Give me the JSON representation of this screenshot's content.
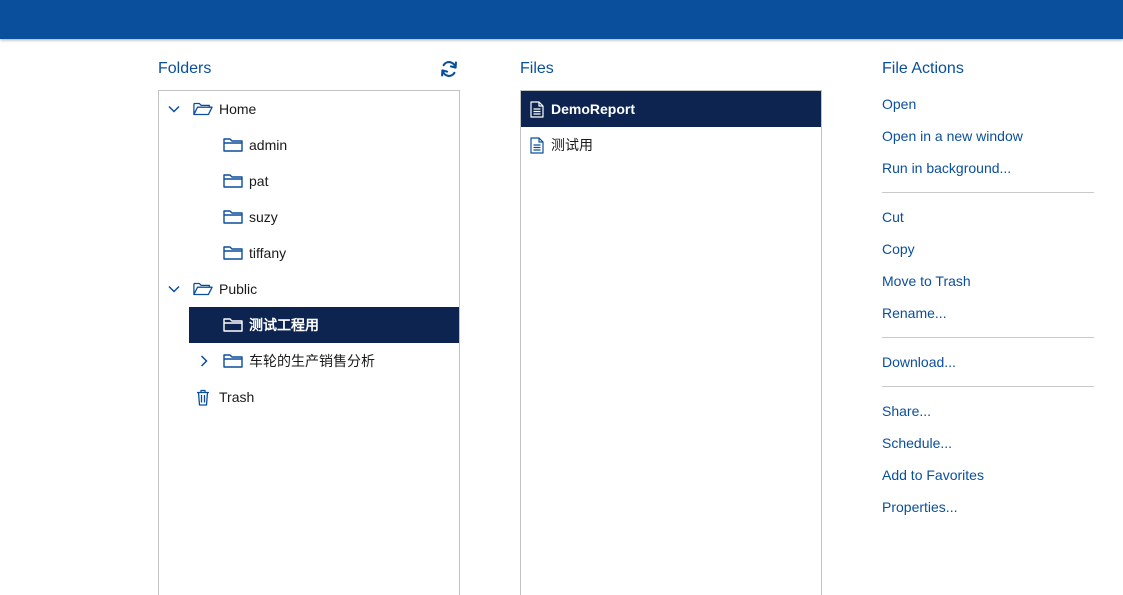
{
  "folders_panel": {
    "title": "Folders",
    "refresh_icon": "refresh-icon",
    "tree": [
      {
        "label": "Home",
        "expanded": true,
        "icon": "folder-open-icon"
      },
      {
        "label": "admin",
        "icon": "folder-icon"
      },
      {
        "label": "pat",
        "icon": "folder-icon"
      },
      {
        "label": "suzy",
        "icon": "folder-icon"
      },
      {
        "label": "tiffany",
        "icon": "folder-icon"
      },
      {
        "label": "Public",
        "expanded": true,
        "icon": "folder-open-icon"
      },
      {
        "label": "测试工程用",
        "selected": true,
        "icon": "folder-icon"
      },
      {
        "label": "车轮的生产销售分析",
        "collapsed": true,
        "icon": "folder-icon"
      },
      {
        "label": "Trash",
        "icon": "trash-icon"
      }
    ]
  },
  "files_panel": {
    "title": "Files",
    "files": [
      {
        "label": "DemoReport",
        "selected": true,
        "icon": "document-icon"
      },
      {
        "label": "测试用",
        "icon": "document-icon"
      }
    ]
  },
  "file_actions": {
    "title": "File Actions",
    "groups": [
      [
        "Open",
        "Open in a new window",
        "Run in background..."
      ],
      [
        "Cut",
        "Copy",
        "Move to Trash",
        "Rename..."
      ],
      [
        "Download..."
      ],
      [
        "Share...",
        "Schedule...",
        "Add to Favorites",
        "Properties..."
      ]
    ]
  },
  "colors": {
    "header_bar": "#0a4f9c",
    "accent_text": "#0a4f9c",
    "selection": "#0d2451"
  }
}
